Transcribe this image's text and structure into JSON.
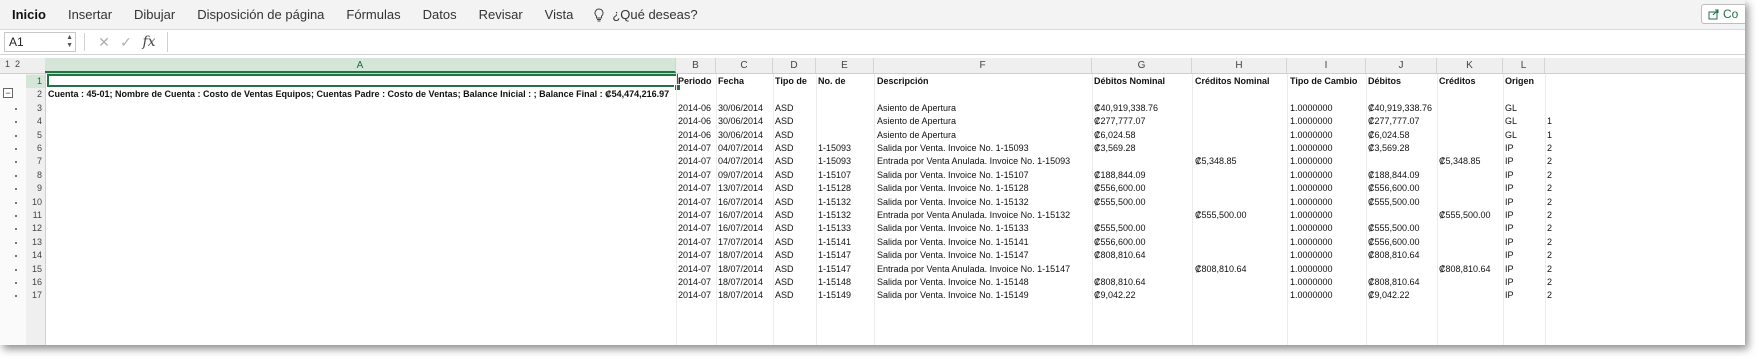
{
  "ribbon": {
    "tabs": [
      "Inicio",
      "Insertar",
      "Dibujar",
      "Disposición de página",
      "Fórmulas",
      "Datos",
      "Revisar",
      "Vista"
    ],
    "tell_me": "¿Qué deseas?",
    "share_label": "Co"
  },
  "formula_bar": {
    "cell_ref": "A1",
    "fx_label": "fx",
    "cancel_icon": "✕",
    "enter_icon": "✓",
    "content": ""
  },
  "outline_levels": [
    "1",
    "2"
  ],
  "outline_minus": "−",
  "columns": [
    "A",
    "B",
    "C",
    "D",
    "E",
    "F",
    "G",
    "H",
    "I",
    "J",
    "K",
    "L"
  ],
  "row_numbers": [
    "1",
    "2",
    "3",
    "4",
    "5",
    "6",
    "7",
    "8",
    "9",
    "10",
    "11",
    "12",
    "13",
    "14",
    "15",
    "16",
    "17"
  ],
  "header_row": {
    "B": "Periodo",
    "C": "Fecha",
    "D": "Tipo de",
    "E": "No. de",
    "F": "Descripción",
    "G": "Débitos Nominal",
    "H": "Créditos Nominal",
    "I": "Tipo de Cambio",
    "J": "Débitos",
    "K": "Créditos",
    "L": "Origen"
  },
  "account_line": "Cuenta  : 45-01;  Nombre de Cuenta : Costo de Ventas Equipos;  Cuentas Padre : Costo de Ventas;  Balance Inicial : ;  Balance Final : ₡54,474,216.97",
  "rows": [
    {
      "B": "2014-06",
      "C": "30/06/2014",
      "D": "ASD",
      "E": "",
      "F": "Asiento de Apertura",
      "G": "₡40,919,338.76",
      "H": "",
      "I": "1.0000000",
      "J": "₡40,919,338.76",
      "K": "",
      "L": "GL",
      "M": ""
    },
    {
      "B": "2014-06",
      "C": "30/06/2014",
      "D": "ASD",
      "E": "",
      "F": "Asiento de Apertura",
      "G": "₡277,777.07",
      "H": "",
      "I": "1.0000000",
      "J": "₡277,777.07",
      "K": "",
      "L": "GL",
      "M": "1"
    },
    {
      "B": "2014-06",
      "C": "30/06/2014",
      "D": "ASD",
      "E": "",
      "F": "Asiento de Apertura",
      "G": "₡6,024.58",
      "H": "",
      "I": "1.0000000",
      "J": "₡6,024.58",
      "K": "",
      "L": "GL",
      "M": "1"
    },
    {
      "B": "2014-07",
      "C": "04/07/2014",
      "D": "ASD",
      "E": "1-15093",
      "F": "Salida por Venta. Invoice No. 1-15093",
      "G": "₡3,569.28",
      "H": "",
      "I": "1.0000000",
      "J": "₡3,569.28",
      "K": "",
      "L": "IP",
      "M": "2"
    },
    {
      "B": "2014-07",
      "C": "04/07/2014",
      "D": "ASD",
      "E": "1-15093",
      "F": "Entrada por Venta Anulada. Invoice No. 1-15093",
      "G": "",
      "H": "₡5,348.85",
      "I": "1.0000000",
      "J": "",
      "K": "₡5,348.85",
      "L": "IP",
      "M": "2"
    },
    {
      "B": "2014-07",
      "C": "09/07/2014",
      "D": "ASD",
      "E": "1-15107",
      "F": "Salida por Venta. Invoice No. 1-15107",
      "G": "₡188,844.09",
      "H": "",
      "I": "1.0000000",
      "J": "₡188,844.09",
      "K": "",
      "L": "IP",
      "M": "2"
    },
    {
      "B": "2014-07",
      "C": "13/07/2014",
      "D": "ASD",
      "E": "1-15128",
      "F": "Salida por Venta. Invoice No. 1-15128",
      "G": "₡556,600.00",
      "H": "",
      "I": "1.0000000",
      "J": "₡556,600.00",
      "K": "",
      "L": "IP",
      "M": "2"
    },
    {
      "B": "2014-07",
      "C": "16/07/2014",
      "D": "ASD",
      "E": "1-15132",
      "F": "Salida por Venta. Invoice No. 1-15132",
      "G": "₡555,500.00",
      "H": "",
      "I": "1.0000000",
      "J": "₡555,500.00",
      "K": "",
      "L": "IP",
      "M": "2"
    },
    {
      "B": "2014-07",
      "C": "16/07/2014",
      "D": "ASD",
      "E": "1-15132",
      "F": "Entrada por Venta Anulada. Invoice No. 1-15132",
      "G": "",
      "H": "₡555,500.00",
      "I": "1.0000000",
      "J": "",
      "K": "₡555,500.00",
      "L": "IP",
      "M": "2"
    },
    {
      "B": "2014-07",
      "C": "16/07/2014",
      "D": "ASD",
      "E": "1-15133",
      "F": "Salida por Venta. Invoice No. 1-15133",
      "G": "₡555,500.00",
      "H": "",
      "I": "1.0000000",
      "J": "₡555,500.00",
      "K": "",
      "L": "IP",
      "M": "2"
    },
    {
      "B": "2014-07",
      "C": "17/07/2014",
      "D": "ASD",
      "E": "1-15141",
      "F": "Salida por Venta. Invoice No. 1-15141",
      "G": "₡556,600.00",
      "H": "",
      "I": "1.0000000",
      "J": "₡556,600.00",
      "K": "",
      "L": "IP",
      "M": "2"
    },
    {
      "B": "2014-07",
      "C": "18/07/2014",
      "D": "ASD",
      "E": "1-15147",
      "F": "Salida por Venta. Invoice No. 1-15147",
      "G": "₡808,810.64",
      "H": "",
      "I": "1.0000000",
      "J": "₡808,810.64",
      "K": "",
      "L": "IP",
      "M": "2"
    },
    {
      "B": "2014-07",
      "C": "18/07/2014",
      "D": "ASD",
      "E": "1-15147",
      "F": "Entrada por Venta Anulada. Invoice No. 1-15147",
      "G": "",
      "H": "₡808,810.64",
      "I": "1.0000000",
      "J": "",
      "K": "₡808,810.64",
      "L": "IP",
      "M": "2"
    },
    {
      "B": "2014-07",
      "C": "18/07/2014",
      "D": "ASD",
      "E": "1-15148",
      "F": "Salida por Venta. Invoice No. 1-15148",
      "G": "₡808,810.64",
      "H": "",
      "I": "1.0000000",
      "J": "₡808,810.64",
      "K": "",
      "L": "IP",
      "M": "2"
    },
    {
      "B": "2014-07",
      "C": "18/07/2014",
      "D": "ASD",
      "E": "1-15149",
      "F": "Salida por Venta. Invoice No. 1-15149",
      "G": "₡9,042.22",
      "H": "",
      "I": "1.0000000",
      "J": "₡9,042.22",
      "K": "",
      "L": "IP",
      "M": "2"
    }
  ],
  "colors": {
    "accent": "#217346",
    "selection_fill": "#d3e6d8",
    "header_bg": "#efefef"
  }
}
